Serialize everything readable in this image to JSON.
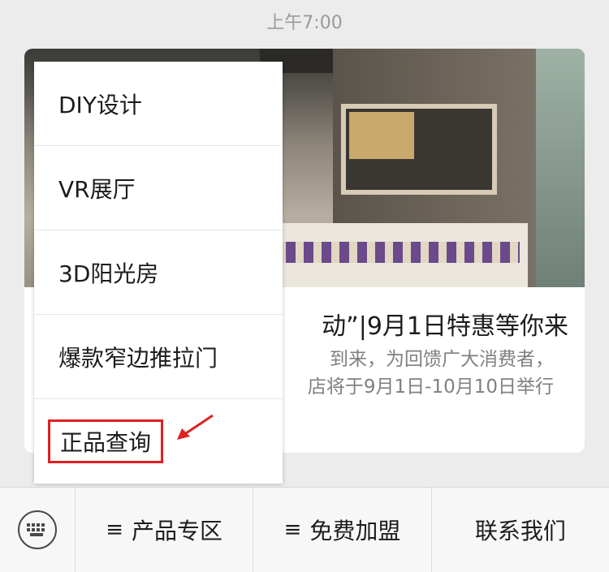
{
  "timestamp": "上午7:00",
  "article": {
    "title_visible": "动”|9月1日特惠等你来",
    "desc_line1": "到来，为回馈广大消费者，",
    "desc_line2": "店将于9月1日-10月10日举行"
  },
  "menu": {
    "items": [
      {
        "label": "DIY设计"
      },
      {
        "label": "VR展厅"
      },
      {
        "label": "3D阳光房"
      },
      {
        "label": "爆款窄边推拉门"
      },
      {
        "label": "正品查询"
      }
    ]
  },
  "bottom_bar": {
    "keyboard_icon": "keyboard-icon",
    "items": [
      {
        "label": "产品专区",
        "icon": "menu-lines-icon"
      },
      {
        "label": "免费加盟",
        "icon": "menu-lines-icon"
      },
      {
        "label": "联系我们"
      }
    ]
  },
  "colors": {
    "highlight": "#e02020",
    "background": "#ececec"
  }
}
